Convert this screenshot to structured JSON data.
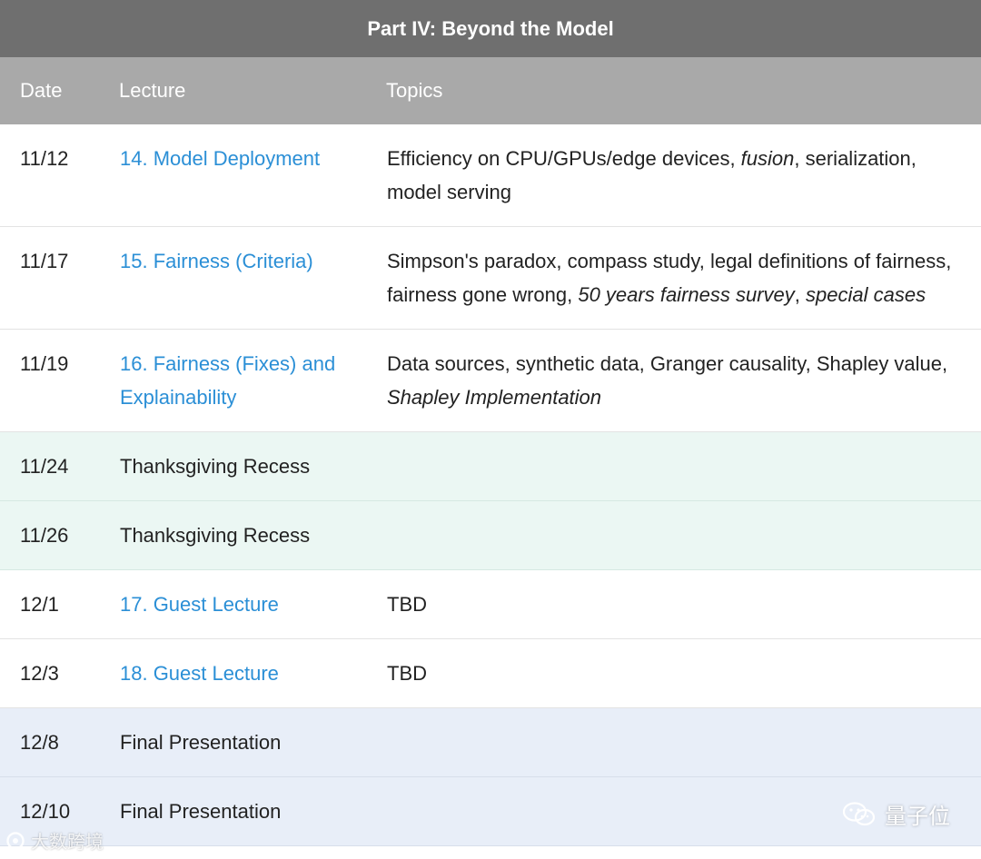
{
  "header": {
    "title": "Part IV: Beyond the Model"
  },
  "columns": {
    "date": "Date",
    "lecture": "Lecture",
    "topics": "Topics"
  },
  "rows": [
    {
      "date": "11/12",
      "lecture": "14. Model Deployment",
      "lecture_is_link": true,
      "topics": [
        {
          "t": "Efficiency on CPU/GPUs/edge devices, ",
          "i": false
        },
        {
          "t": "fusion",
          "i": true
        },
        {
          "t": ", serialization, model serving",
          "i": false
        }
      ]
    },
    {
      "date": "11/17",
      "lecture": "15. Fairness (Criteria)",
      "lecture_is_link": true,
      "topics": [
        {
          "t": "Simpson's paradox, compass study, legal definitions of fairness, fairness gone wrong, ",
          "i": false
        },
        {
          "t": "50 years fairness survey",
          "i": true
        },
        {
          "t": ", ",
          "i": false
        },
        {
          "t": "special cases",
          "i": true
        }
      ]
    },
    {
      "date": "11/19",
      "lecture": "16. Fairness (Fixes) and Explainability",
      "lecture_is_link": true,
      "topics": [
        {
          "t": "Data sources, synthetic data, Granger causality, Shapley value, ",
          "i": false
        },
        {
          "t": "Shapley Implementation",
          "i": true
        }
      ]
    },
    {
      "date": "11/24",
      "lecture": "Thanksgiving Recess",
      "lecture_is_link": false,
      "kind": "recess",
      "topics": []
    },
    {
      "date": "11/26",
      "lecture": "Thanksgiving Recess",
      "lecture_is_link": false,
      "kind": "recess",
      "topics": []
    },
    {
      "date": "12/1",
      "lecture": "17. Guest Lecture",
      "lecture_is_link": true,
      "topics": [
        {
          "t": "TBD",
          "i": false
        }
      ]
    },
    {
      "date": "12/3",
      "lecture": "18. Guest Lecture",
      "lecture_is_link": true,
      "topics": [
        {
          "t": "TBD",
          "i": false
        }
      ]
    },
    {
      "date": "12/8",
      "lecture": "Final Presentation",
      "lecture_is_link": false,
      "kind": "final",
      "topics": []
    },
    {
      "date": "12/10",
      "lecture": "Final Presentation",
      "lecture_is_link": false,
      "kind": "final",
      "topics": []
    }
  ],
  "watermarks": {
    "left": "大数跨境",
    "right": "量子位"
  },
  "colors": {
    "header_bg": "#6f6f6f",
    "column_header_bg": "#a9a9a9",
    "link": "#2b8fd6",
    "recess_bg": "#ebf7f3",
    "final_bg": "#e8eef8"
  },
  "icons": {
    "left_watermark": "circle-logo-icon",
    "right_watermark": "wechat-icon"
  }
}
